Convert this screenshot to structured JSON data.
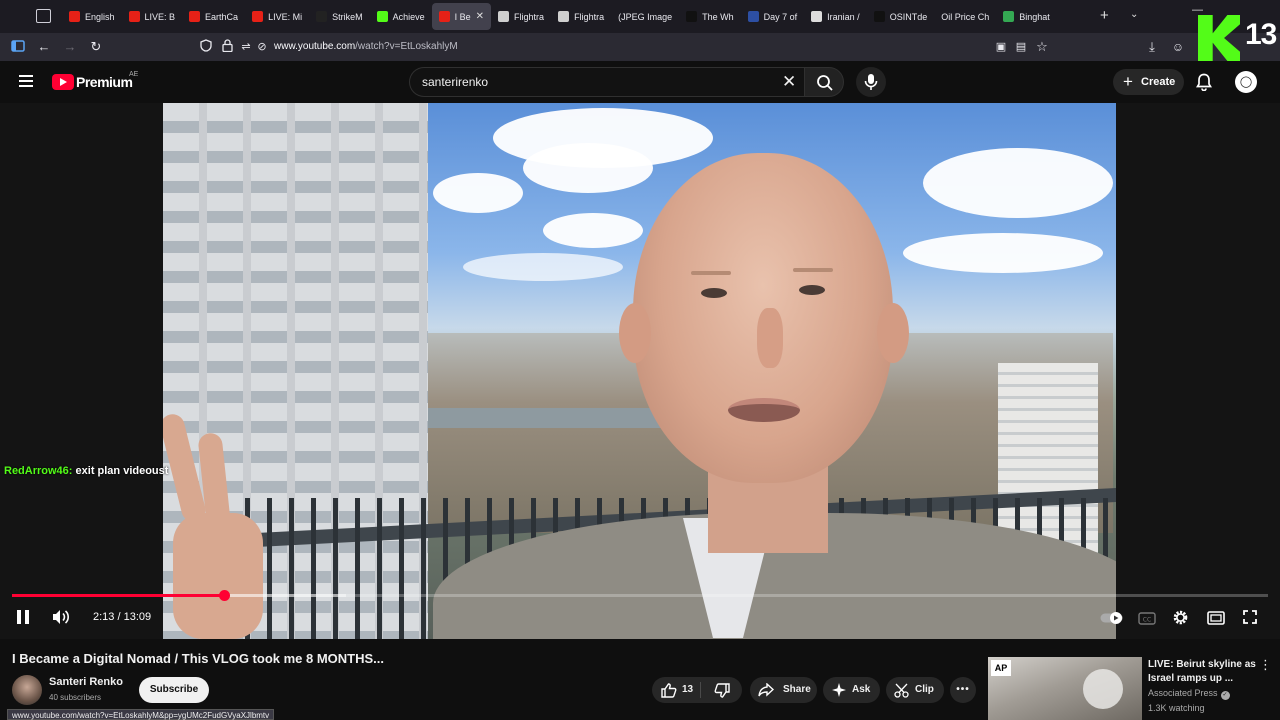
{
  "browser": {
    "tabs": [
      {
        "label": "English",
        "favicon": "youtube-red-icon",
        "active": false
      },
      {
        "label": "LIVE: B",
        "favicon": "youtube-muted-icon",
        "active": false
      },
      {
        "label": "EarthCa",
        "favicon": "youtube-icon",
        "active": false
      },
      {
        "label": "LIVE: Mi",
        "favicon": "youtube-icon",
        "active": false
      },
      {
        "label": "StrikeM",
        "favicon": "strike-icon",
        "active": false
      },
      {
        "label": "Achieve",
        "favicon": "kick-icon",
        "active": false
      },
      {
        "label": "I Be",
        "favicon": "youtube-sound-icon",
        "active": true
      },
      {
        "label": "Flightra",
        "favicon": "flightradar-icon",
        "active": false
      },
      {
        "label": "Flightra",
        "favicon": "flightradar-icon",
        "active": false
      },
      {
        "label": "(JPEG Image",
        "favicon": "",
        "active": false
      },
      {
        "label": "The Wh",
        "favicon": "tiktok-icon",
        "active": false
      },
      {
        "label": "Day 7 of",
        "favicon": "news-icon",
        "active": false
      },
      {
        "label": "Iranian /",
        "favicon": "wikipedia-icon",
        "active": false
      },
      {
        "label": "OSINTde",
        "favicon": "x-icon",
        "active": false
      },
      {
        "label": "Oil Price Ch",
        "favicon": "",
        "active": false
      },
      {
        "label": "Binghat",
        "favicon": "maps-pin-icon",
        "active": false
      }
    ],
    "url_host": "www.youtube.com",
    "url_path": "/watch?v=EtLoskahlyM",
    "overlay_number": "13",
    "status_bar_url": "www.youtube.com/watch?v=EtLoskahlyM&pp=ygUMc2FudGVyaXJlbmtv"
  },
  "masthead": {
    "brand": "Premium",
    "region": "AE",
    "search_value": "santerirenko",
    "create_label": "Create"
  },
  "player": {
    "time_display": "2:13 / 13:09",
    "progress_fraction": 0.169,
    "buffered_fraction": 0.266,
    "chat_user": "RedArrow46:",
    "chat_text": " exit plan videoust"
  },
  "video": {
    "title": "I Became a Digital Nomad / This VLOG took me 8 MONTHS...",
    "channel_name": "Santeri Renko",
    "subscribers": "40 subscribers",
    "subscribe_label": "Subscribe",
    "like_count": "13",
    "share_label": "Share",
    "ask_label": "Ask",
    "clip_label": "Clip"
  },
  "recommendation": {
    "badge": "AP",
    "title": "LIVE: Beirut skyline as Israel ramps up ...",
    "channel": "Associated Press",
    "watching": "1.3K watching"
  },
  "colors": {
    "youtube_red": "#ff0033",
    "kick_green": "#53fc18",
    "background": "#0f0f0f"
  }
}
